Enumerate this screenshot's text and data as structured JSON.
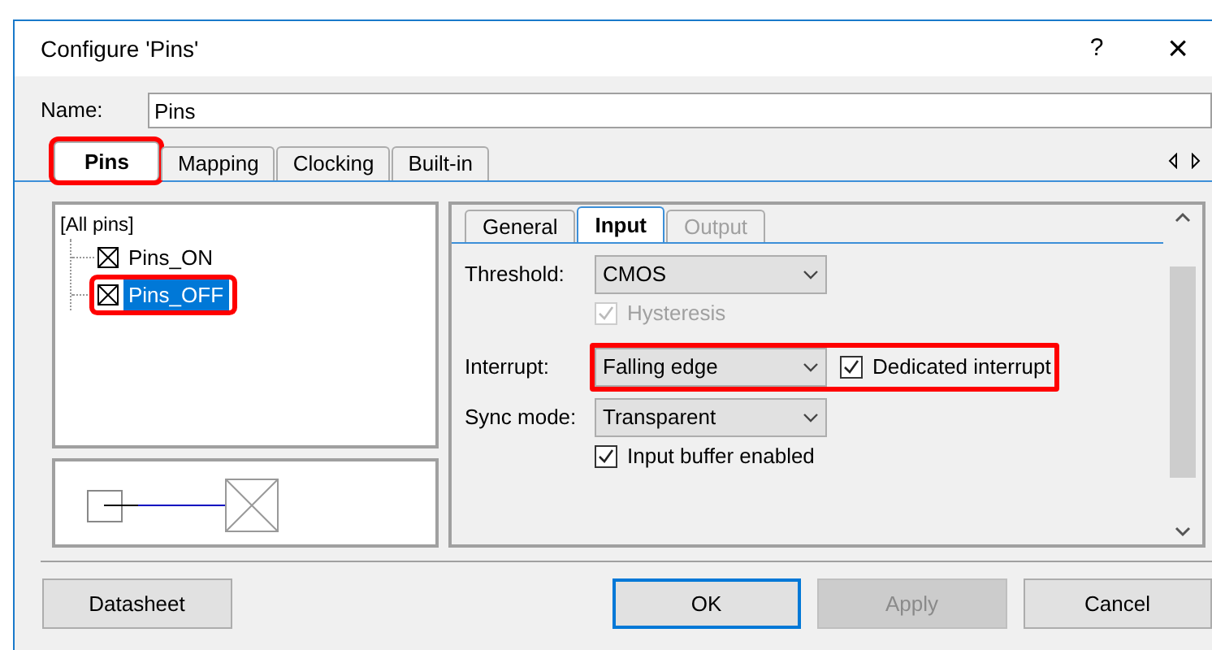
{
  "window": {
    "title": "Configure 'Pins'",
    "help": "?",
    "close": "×"
  },
  "name": {
    "label": "Name:",
    "value": "Pins"
  },
  "tabs": [
    {
      "label": "Pins",
      "selected": true,
      "highlighted": true
    },
    {
      "label": "Mapping",
      "selected": false,
      "highlighted": false
    },
    {
      "label": "Clocking",
      "selected": false,
      "highlighted": false
    },
    {
      "label": "Built-in",
      "selected": false,
      "highlighted": false
    }
  ],
  "tree": {
    "label": "[All pins]",
    "children": [
      {
        "label": "Pins_ON",
        "selected": false,
        "highlighted": false
      },
      {
        "label": "Pins_OFF",
        "selected": true,
        "highlighted": true
      }
    ]
  },
  "subtabs": [
    {
      "label": "General",
      "selected": false,
      "disabled": false
    },
    {
      "label": "Input",
      "selected": true,
      "disabled": false
    },
    {
      "label": "Output",
      "selected": false,
      "disabled": true
    }
  ],
  "fields": [
    {
      "kind": "select",
      "label": "Threshold:",
      "value": "CMOS",
      "highlighted": false
    },
    {
      "kind": "checkbox",
      "label": "Hysteresis",
      "checked": true,
      "disabled": true
    },
    {
      "kind": "select",
      "label": "Interrupt:",
      "value": "Falling edge",
      "highlighted": true,
      "checkbox": {
        "label": "Dedicated interrupt",
        "checked": true
      }
    },
    {
      "kind": "select",
      "label": "Sync mode:",
      "value": "Transparent",
      "highlighted": false
    },
    {
      "kind": "checkbox",
      "label": "Input buffer enabled",
      "checked": true,
      "disabled": false
    }
  ],
  "buttons": [
    {
      "label": "Datasheet",
      "default": false,
      "disabled": false
    },
    {
      "label": "OK",
      "default": true,
      "disabled": false
    },
    {
      "label": "Apply",
      "default": false,
      "disabled": true
    },
    {
      "label": "Cancel",
      "default": false,
      "disabled": false
    }
  ]
}
